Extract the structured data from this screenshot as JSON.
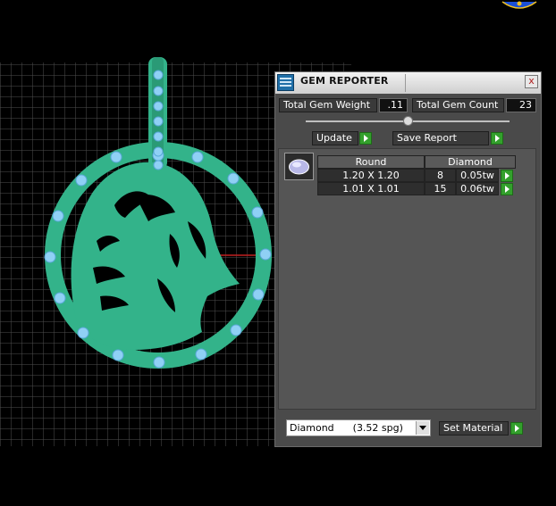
{
  "panel": {
    "title": "GEM REPORTER",
    "close_glyph": "x",
    "total_gem_weight_label": "Total Gem Weight",
    "total_gem_weight_value": ".11",
    "total_gem_count_label": "Total Gem Count",
    "total_gem_count_value": "23",
    "slider_level": 0.5,
    "update_label": "Update",
    "save_report_label": "Save Report",
    "table": {
      "headers": [
        "Round",
        "Diamond"
      ],
      "rows": [
        {
          "size": "1.20 X 1.20",
          "count": "8",
          "weight": "0.05tw"
        },
        {
          "size": "1.01 X 1.01",
          "count": "15",
          "weight": "0.06tw"
        }
      ]
    },
    "material_selected": "Diamond      (3.52 spg)",
    "set_material_label": "Set Material"
  },
  "colors": {
    "model": "#33b38a",
    "gem": "#8fd0f5",
    "panel_bg": "#4a4a4a",
    "go_button": "#33a02c",
    "grid": "#5a5a5a"
  },
  "icons": [
    "gem-reporter-icon",
    "close-icon",
    "slider-knob",
    "arrow-right-icon",
    "gem-thumbnail-icon",
    "chevron-down-icon",
    "logo-icon"
  ]
}
